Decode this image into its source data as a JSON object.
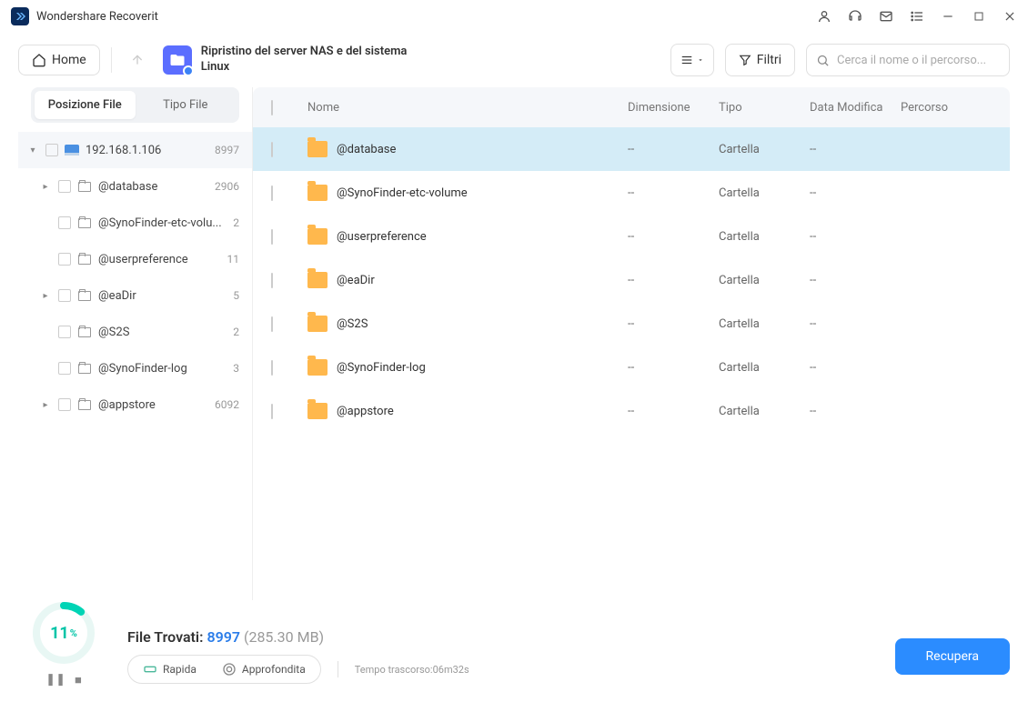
{
  "app": {
    "title": "Wondershare Recoverit"
  },
  "toolbar": {
    "home": "Home",
    "breadcrumb": "Ripristino del server NAS e del sistema Linux",
    "filter": "Filtri",
    "search_placeholder": "Cerca il nome o il percorso..."
  },
  "sidebar": {
    "tabs": {
      "position": "Posizione File",
      "type": "Tipo File"
    },
    "root": {
      "label": "192.168.1.106",
      "count": "8997"
    },
    "items": [
      {
        "label": "@database",
        "count": "2906",
        "expandable": true
      },
      {
        "label": "@SynoFinder-etc-volu...",
        "count": "2",
        "expandable": false
      },
      {
        "label": "@userpreference",
        "count": "11",
        "expandable": false
      },
      {
        "label": "@eaDir",
        "count": "5",
        "expandable": true
      },
      {
        "label": "@S2S",
        "count": "2",
        "expandable": false
      },
      {
        "label": "@SynoFinder-log",
        "count": "3",
        "expandable": false
      },
      {
        "label": "@appstore",
        "count": "6092",
        "expandable": true
      }
    ]
  },
  "table": {
    "headers": {
      "name": "Nome",
      "dim": "Dimensione",
      "tipo": "Tipo",
      "mod": "Data Modifica",
      "path": "Percorso"
    },
    "rows": [
      {
        "name": "@database",
        "dim": "--",
        "tipo": "Cartella",
        "mod": "--",
        "selected": true
      },
      {
        "name": "@SynoFinder-etc-volume",
        "dim": "--",
        "tipo": "Cartella",
        "mod": "--",
        "selected": false
      },
      {
        "name": "@userpreference",
        "dim": "--",
        "tipo": "Cartella",
        "mod": "--",
        "selected": false
      },
      {
        "name": "@eaDir",
        "dim": "--",
        "tipo": "Cartella",
        "mod": "--",
        "selected": false
      },
      {
        "name": "@S2S",
        "dim": "--",
        "tipo": "Cartella",
        "mod": "--",
        "selected": false
      },
      {
        "name": "@SynoFinder-log",
        "dim": "--",
        "tipo": "Cartella",
        "mod": "--",
        "selected": false
      },
      {
        "name": "@appstore",
        "dim": "--",
        "tipo": "Cartella",
        "mod": "--",
        "selected": false
      }
    ]
  },
  "footer": {
    "percent": "11",
    "found_label": "File Trovati: ",
    "found_count": "8997",
    "found_size": " (285.30 MB)",
    "scan_fast": "Rapida",
    "scan_deep": "Approfondita",
    "elapsed": "Tempo trascorso:06m32s",
    "recover": "Recupera"
  }
}
